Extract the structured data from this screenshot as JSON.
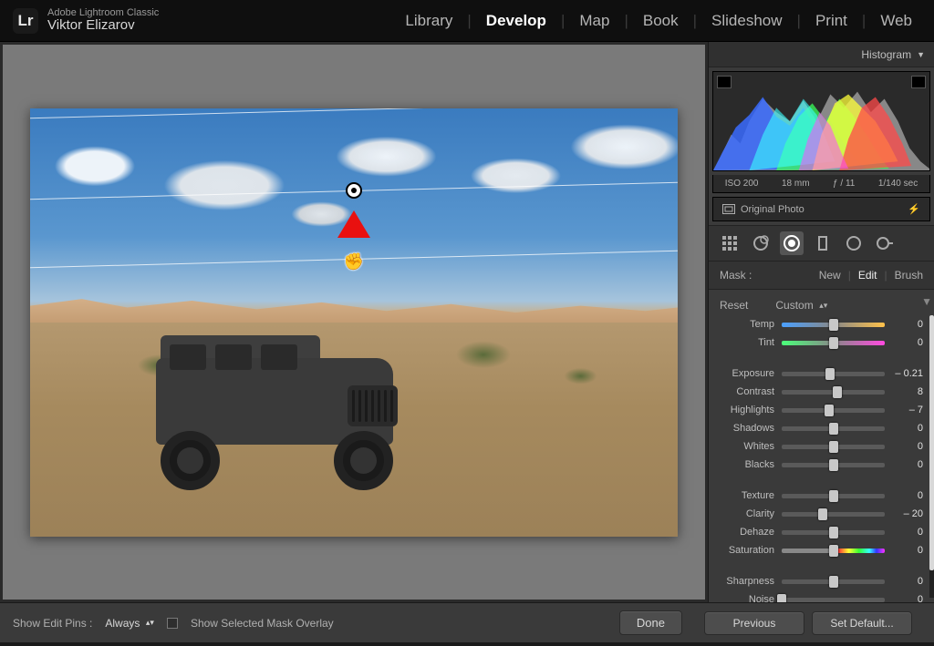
{
  "app": {
    "name": "Adobe Lightroom Classic",
    "user": "Viktor Elizarov",
    "logo": "Lr"
  },
  "modules": {
    "items": [
      "Library",
      "Develop",
      "Map",
      "Book",
      "Slideshow",
      "Print",
      "Web"
    ],
    "active": "Develop"
  },
  "histogram": {
    "title": "Histogram",
    "iso": "ISO 200",
    "focal": "18 mm",
    "aperture": "ƒ / 11",
    "shutter": "1/140 sec",
    "original_label": "Original Photo"
  },
  "mask": {
    "label": "Mask :",
    "modes": {
      "new": "New",
      "edit": "Edit",
      "brush": "Brush",
      "active": "Edit"
    },
    "reset": "Reset",
    "profile": "Custom"
  },
  "sliders": [
    {
      "group": 0,
      "name": "Temp",
      "value": 0,
      "pos": 50,
      "track": "temp"
    },
    {
      "group": 0,
      "name": "Tint",
      "value": 0,
      "pos": 50,
      "track": "tint"
    },
    {
      "group": 1,
      "name": "Exposure",
      "value": "– 0.21",
      "pos": 47
    },
    {
      "group": 1,
      "name": "Contrast",
      "value": 8,
      "pos": 54
    },
    {
      "group": 1,
      "name": "Highlights",
      "value": "– 7",
      "pos": 46
    },
    {
      "group": 1,
      "name": "Shadows",
      "value": 0,
      "pos": 50
    },
    {
      "group": 1,
      "name": "Whites",
      "value": 0,
      "pos": 50
    },
    {
      "group": 1,
      "name": "Blacks",
      "value": 0,
      "pos": 50
    },
    {
      "group": 2,
      "name": "Texture",
      "value": 0,
      "pos": 50
    },
    {
      "group": 2,
      "name": "Clarity",
      "value": "– 20",
      "pos": 40
    },
    {
      "group": 2,
      "name": "Dehaze",
      "value": 0,
      "pos": 50
    },
    {
      "group": 2,
      "name": "Saturation",
      "value": 0,
      "pos": 50,
      "track": "sat"
    },
    {
      "group": 3,
      "name": "Sharpness",
      "value": 0,
      "pos": 50
    },
    {
      "group": 3,
      "name": "Noise",
      "value": 0,
      "pos": 0
    }
  ],
  "toolbar": {
    "show_pins_label": "Show Edit Pins :",
    "show_pins_value": "Always",
    "mask_overlay_label": "Show Selected Mask Overlay",
    "done": "Done",
    "previous": "Previous",
    "set_default": "Set Default..."
  }
}
